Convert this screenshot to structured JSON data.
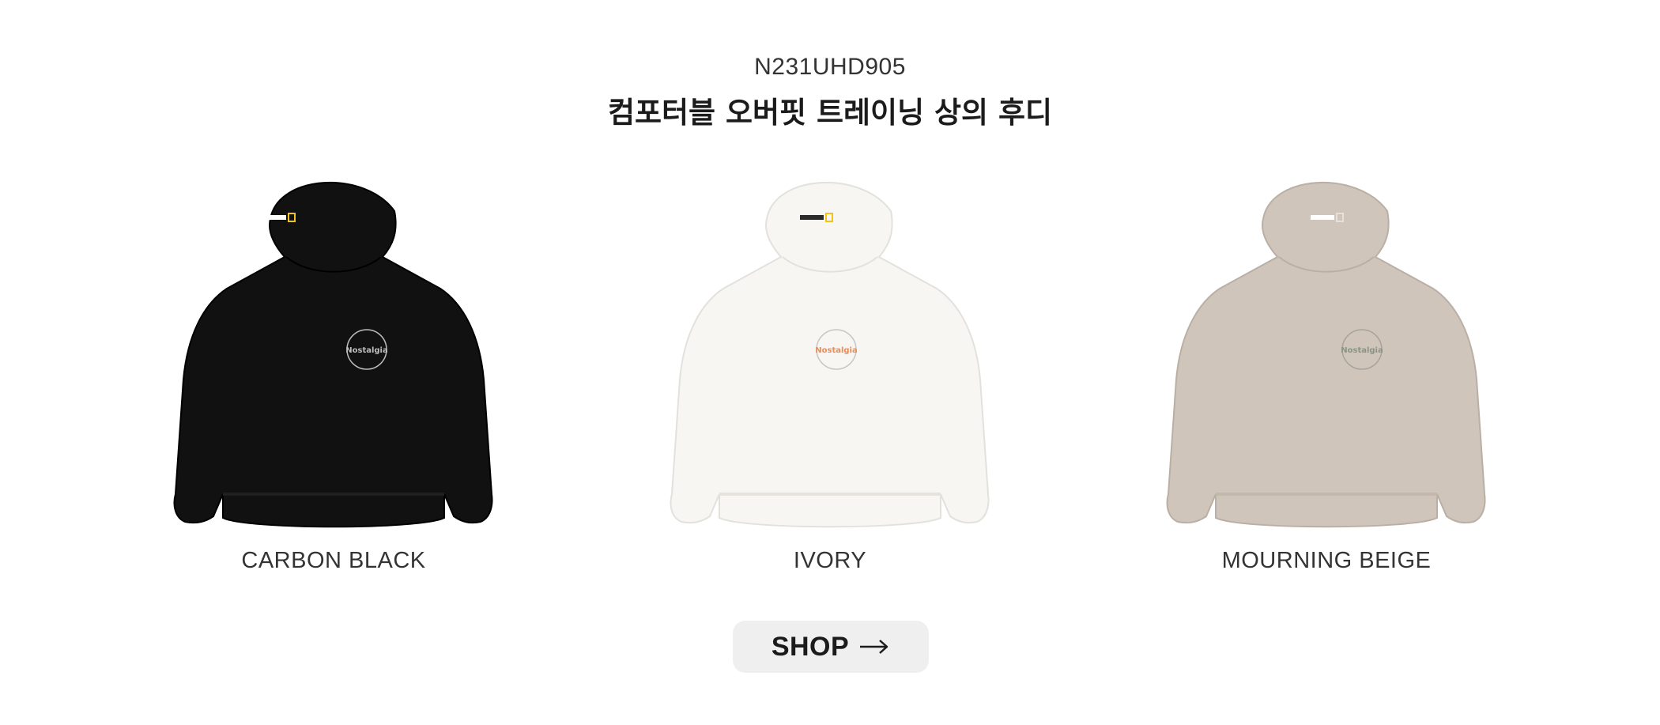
{
  "product": {
    "code": "N231UHD905",
    "title": "컴포터블 오버핏 트레이닝 상의 후디"
  },
  "colors": [
    {
      "label": "CARBON BLACK",
      "swatch": "#111111",
      "trim": "#161616",
      "logo": "#bdbdbd"
    },
    {
      "label": "IVORY",
      "swatch": "#f7f6f3",
      "trim": "#f1f0ec",
      "logo": "#f08a52"
    },
    {
      "label": "MOURNING BEIGE",
      "swatch": "#cfc5bb",
      "trim": "#c7bdb2",
      "logo": "#8a9486"
    }
  ],
  "cta": {
    "label": "SHOP",
    "icon": "arrow-right-icon"
  }
}
